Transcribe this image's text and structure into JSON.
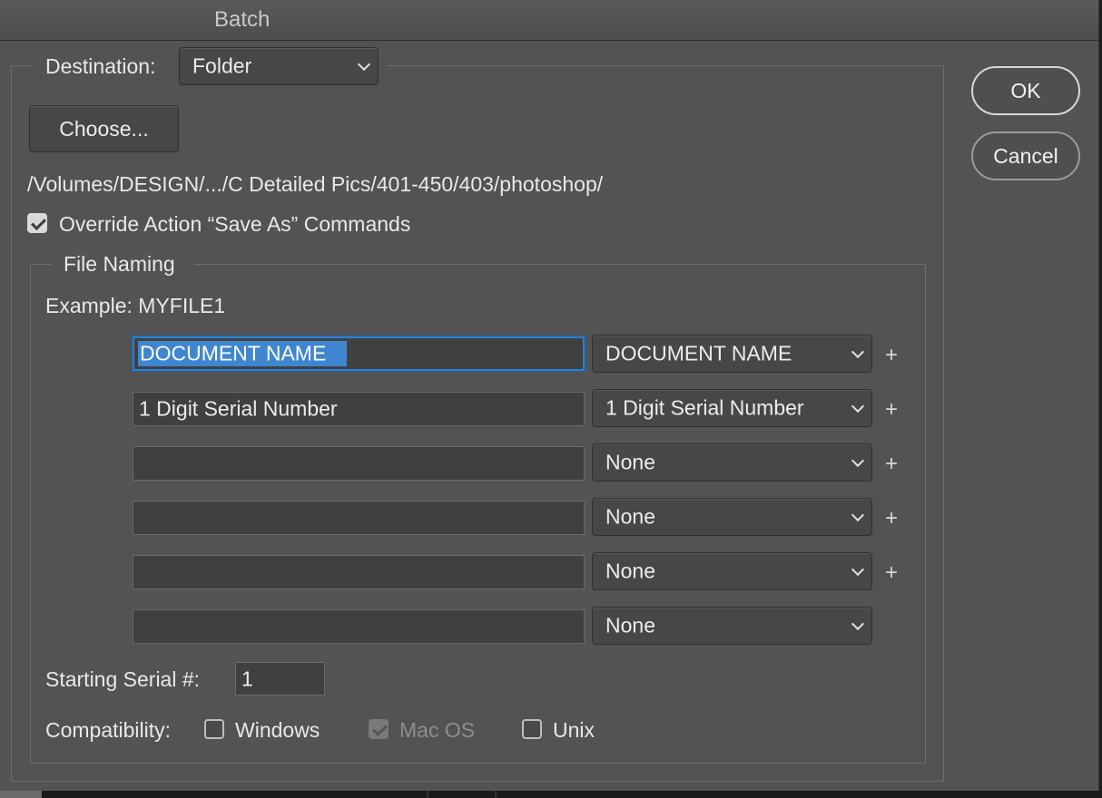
{
  "window": {
    "title": "Batch"
  },
  "destination": {
    "label": "Destination:",
    "selected": "Folder",
    "choose_label": "Choose...",
    "path": "/Volumes/DESIGN/.../C Detailed Pics/401-450/403/photoshop/",
    "override_label": "Override Action “Save As” Commands",
    "override_checked": true
  },
  "file_naming": {
    "legend": "File Naming",
    "example": "Example: MYFILE1",
    "rows": [
      {
        "field": "DOCUMENT NAME",
        "select": "DOCUMENT NAME",
        "plus": "+"
      },
      {
        "field": "1 Digit Serial Number",
        "select": "1 Digit Serial Number",
        "plus": "+"
      },
      {
        "field": "",
        "select": "None",
        "plus": "+"
      },
      {
        "field": "",
        "select": "None",
        "plus": "+"
      },
      {
        "field": "",
        "select": "None",
        "plus": "+"
      },
      {
        "field": "",
        "select": "None",
        "plus": ""
      }
    ],
    "starting_serial_label": "Starting Serial #:",
    "starting_serial_value": "1",
    "compatibility_label": "Compatibility:",
    "compatibility": [
      {
        "label": "Windows",
        "checked": false,
        "disabled": false
      },
      {
        "label": "Mac OS",
        "checked": true,
        "disabled": true
      },
      {
        "label": "Unix",
        "checked": false,
        "disabled": false
      }
    ]
  },
  "buttons": {
    "ok": "OK",
    "cancel": "Cancel"
  }
}
